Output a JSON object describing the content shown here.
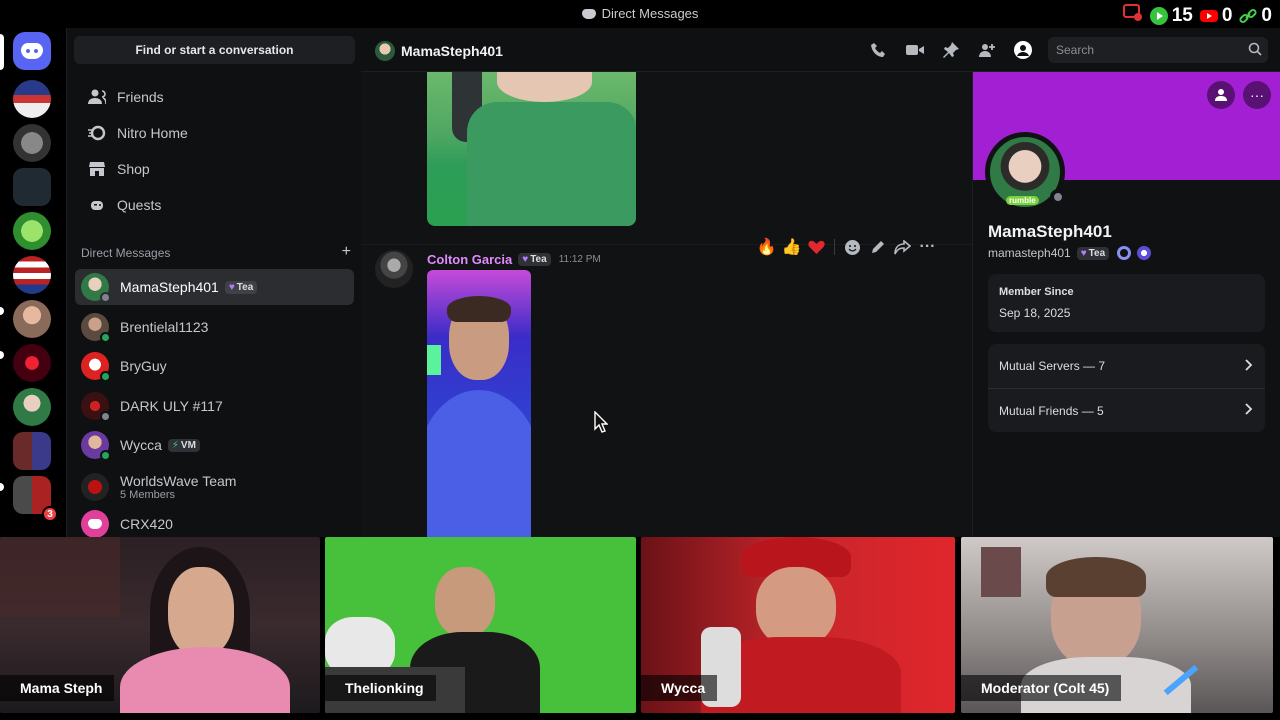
{
  "window": {
    "title": "Direct Messages"
  },
  "stats": {
    "plays": "15",
    "youtube": "0",
    "links": "0"
  },
  "sidebar": {
    "search_label": "Find or start a conversation",
    "nav": [
      {
        "label": "Friends",
        "icon": "friends-icon"
      },
      {
        "label": "Nitro Home",
        "icon": "nitro-icon"
      },
      {
        "label": "Shop",
        "icon": "shop-icon"
      },
      {
        "label": "Quests",
        "icon": "quests-icon"
      }
    ],
    "dm_header": "Direct Messages",
    "dms": [
      {
        "name": "MamaSteph401",
        "tag": "Tea",
        "active": true
      },
      {
        "name": "Brentielal1123"
      },
      {
        "name": "BryGuy"
      },
      {
        "name": "DARK ULY #117"
      },
      {
        "name": "Wycca",
        "tag": "VM"
      },
      {
        "name": "WorldsWave Team",
        "sub": "5 Members"
      },
      {
        "name": "CRX420"
      }
    ]
  },
  "server_badge": "3",
  "chat": {
    "header_name": "MamaSteph401",
    "search_placeholder": "Search",
    "message": {
      "author": "Colton Garcia",
      "tag": "Tea",
      "time": "11:12 PM"
    }
  },
  "profile": {
    "display_name": "MamaSteph401",
    "username": "mamasteph401",
    "tag": "Tea",
    "avatar_overlay": "rumble",
    "member_since_label": "Member Since",
    "member_since": "Sep 18, 2025",
    "mutual_servers": "Mutual Servers — 7",
    "mutual_friends": "Mutual Friends — 5"
  },
  "video": [
    {
      "name": "Mama Steph"
    },
    {
      "name": "Thelionking"
    },
    {
      "name": "Wycca"
    },
    {
      "name": "Moderator (Colt 45)"
    }
  ],
  "colors": {
    "blurple": "#5865f2",
    "banner": "#a31fd3",
    "author": "#e08bff",
    "online": "#23a55a",
    "offline": "#80848e"
  }
}
